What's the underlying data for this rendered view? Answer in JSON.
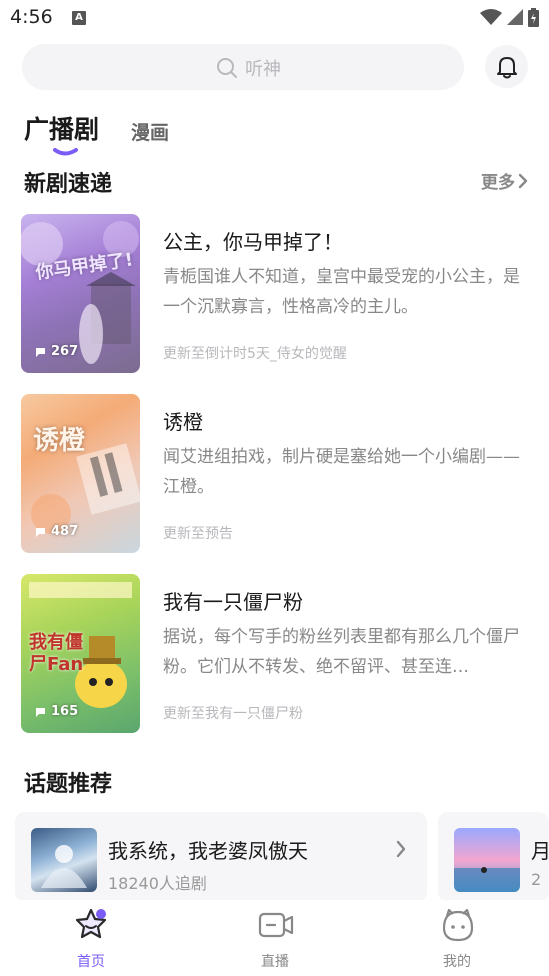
{
  "status_bar": {
    "time": "4:56",
    "a_badge": "A"
  },
  "search": {
    "placeholder": "听神"
  },
  "tabs": [
    {
      "label": "广播剧",
      "active": true
    },
    {
      "label": "漫画",
      "active": false
    }
  ],
  "new_dramas": {
    "title": "新剧速递",
    "more_label": "更多",
    "items": [
      {
        "title": "公主，你马甲掉了！",
        "cover_title": "你马甲掉了!",
        "plays": "267",
        "description": "青栀国谁人不知道，皇宫中最受宠的小公主，是一个沉默寡言，性格高冷的主儿。",
        "update": "更新至倒计时5天_侍女的觉醒"
      },
      {
        "title": "诱橙",
        "cover_title": "诱橙",
        "plays": "487",
        "description": "闻艾进组拍戏，制片硬是塞给她一个小编剧——江橙。",
        "update": "更新至预告"
      },
      {
        "title": "我有一只僵尸粉",
        "cover_title": "我有僵尸Fan",
        "plays": "165",
        "description": "据说，每个写手的粉丝列表里都有那么几个僵尸粉。它们从不转发、绝不留评、甚至连…",
        "update": "更新至我有一只僵尸粉"
      }
    ]
  },
  "topics": {
    "title": "话题推荐",
    "items": [
      {
        "name": "我系统，我老婆凤傲天",
        "followers": "18240人追剧"
      },
      {
        "name": "月",
        "followers": "2"
      }
    ]
  },
  "bottom_nav": [
    {
      "label": "首页",
      "active": true
    },
    {
      "label": "直播",
      "active": false
    },
    {
      "label": "我的",
      "active": false
    }
  ],
  "colors": {
    "accent": "#7c5cf6",
    "text_primary": "#1a1a1a",
    "text_secondary": "#888888"
  }
}
